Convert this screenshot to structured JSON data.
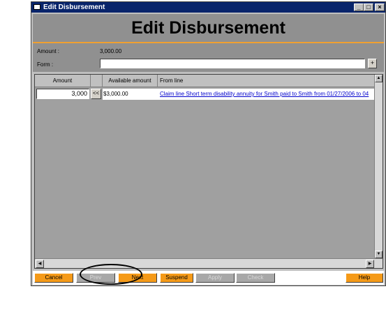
{
  "window": {
    "title": "Edit Disbursement"
  },
  "header": {
    "heading": "Edit Disbursement"
  },
  "fields": {
    "amount_label": "Amount :",
    "amount_value": "3,000.00",
    "form_label": "Form :",
    "form_value": "",
    "form_plus": "+"
  },
  "grid": {
    "columns": [
      "Amount",
      "",
      "Available amount",
      "From line"
    ],
    "rows": [
      {
        "amount": "3,000",
        "copy_button": "<<",
        "available": "$3,000.00",
        "from_line": "Claim line Short term disability annuity for Smith paid to Smith from 01/27/2006 to 04"
      }
    ]
  },
  "buttons": {
    "cancel": "Cancel",
    "prev": "Prev",
    "next": "Next",
    "suspend": "Suspend",
    "apply": "Apply",
    "check": "Check",
    "help": "Help"
  },
  "colors": {
    "titlebar": "#08246b",
    "accent": "#f59a18",
    "link": "#0000cc"
  }
}
